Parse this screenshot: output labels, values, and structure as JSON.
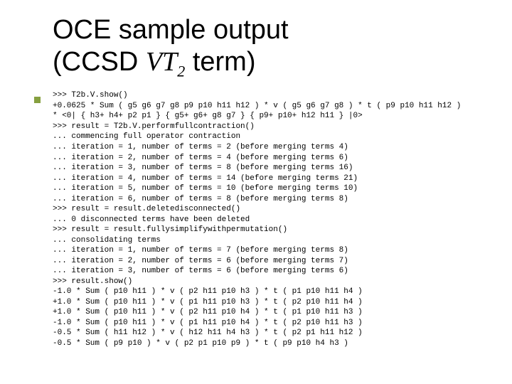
{
  "title": {
    "line1": "OCE sample output",
    "line2_pre": "(CCSD ",
    "line2_vt": "VT",
    "line2_sub": "2",
    "line2_post": " term)"
  },
  "code_lines": [
    ">>> T2b.V.show()",
    "+0.0625 * Sum ( g5 g6 g7 g8 p9 p10 h11 h12 ) * v ( g5 g6 g7 g8 ) * t ( p9 p10 h11 h12 )",
    "* <0| { h3+ h4+ p2 p1 } { g5+ g6+ g8 g7 } { p9+ p10+ h12 h11 } |0>",
    ">>> result = T2b.V.performfullcontraction()",
    "... commencing full operator contraction",
    "... iteration = 1, number of terms = 2 (before merging terms 4)",
    "... iteration = 2, number of terms = 4 (before merging terms 6)",
    "... iteration = 3, number of terms = 8 (before merging terms 16)",
    "... iteration = 4, number of terms = 14 (before merging terms 21)",
    "... iteration = 5, number of terms = 10 (before merging terms 10)",
    "... iteration = 6, number of terms = 8 (before merging terms 8)",
    ">>> result = result.deletedisconnected()",
    "... 0 disconnected terms have been deleted",
    ">>> result = result.fullysimplifywithpermutation()",
    "... consolidating terms",
    "... iteration = 1, number of terms = 7 (before merging terms 8)",
    "... iteration = 2, number of terms = 6 (before merging terms 7)",
    "... iteration = 3, number of terms = 6 (before merging terms 6)",
    ">>> result.show()",
    "-1.0 * Sum ( p10 h11 ) * v ( p2 h11 p10 h3 ) * t ( p1 p10 h11 h4 )",
    "+1.0 * Sum ( p10 h11 ) * v ( p1 h11 p10 h3 ) * t ( p2 p10 h11 h4 )",
    "+1.0 * Sum ( p10 h11 ) * v ( p2 h11 p10 h4 ) * t ( p1 p10 h11 h3 )",
    "-1.0 * Sum ( p10 h11 ) * v ( p1 h11 p10 h4 ) * t ( p2 p10 h11 h3 )",
    "-0.5 * Sum ( h11 h12 ) * v ( h12 h11 h4 h3 ) * t ( p2 p1 h11 h12 )",
    "-0.5 * Sum ( p9 p10 ) * v ( p2 p1 p10 p9 ) * t ( p9 p10 h4 h3 )"
  ]
}
